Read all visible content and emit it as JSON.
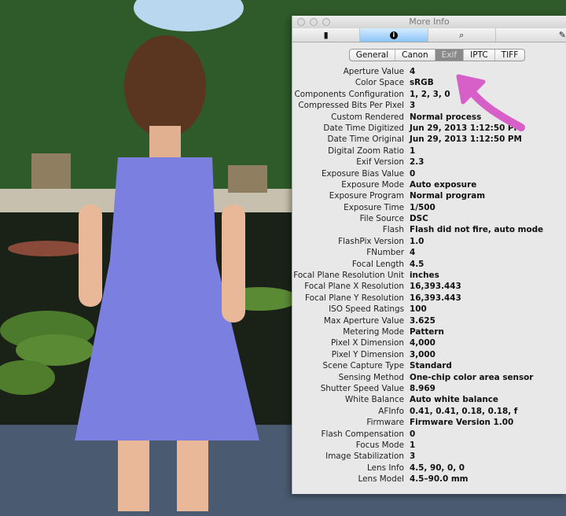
{
  "window": {
    "title": "More Info"
  },
  "toolbar": {
    "items": [
      {
        "icon": "document-icon"
      },
      {
        "icon": "info-icon",
        "selected": true
      },
      {
        "icon": "magnifier-icon"
      },
      {
        "icon": "pencil-icon"
      }
    ]
  },
  "tabs": [
    {
      "label": "General"
    },
    {
      "label": "Canon"
    },
    {
      "label": "Exif",
      "selected": true
    },
    {
      "label": "IPTC"
    },
    {
      "label": "TIFF"
    }
  ],
  "exif": [
    {
      "label": "Aperture Value",
      "value": "4"
    },
    {
      "label": "Color Space",
      "value": "sRGB"
    },
    {
      "label": "Components Configuration",
      "value": "1, 2, 3, 0"
    },
    {
      "label": "Compressed Bits Per Pixel",
      "value": "3"
    },
    {
      "label": "Custom Rendered",
      "value": "Normal process"
    },
    {
      "label": "Date Time Digitized",
      "value": "Jun 29, 2013 1:12:50 PM"
    },
    {
      "label": "Date Time Original",
      "value": "Jun 29, 2013 1:12:50 PM"
    },
    {
      "label": "Digital Zoom Ratio",
      "value": "1"
    },
    {
      "label": "Exif Version",
      "value": "2.3"
    },
    {
      "label": "Exposure Bias Value",
      "value": "0"
    },
    {
      "label": "Exposure Mode",
      "value": "Auto exposure"
    },
    {
      "label": "Exposure Program",
      "value": "Normal program"
    },
    {
      "label": "Exposure Time",
      "value": "1/500"
    },
    {
      "label": "File Source",
      "value": "DSC"
    },
    {
      "label": "Flash",
      "value": "Flash did not fire, auto mode"
    },
    {
      "label": "FlashPix Version",
      "value": "1.0"
    },
    {
      "label": "FNumber",
      "value": "4"
    },
    {
      "label": "Focal Length",
      "value": "4.5"
    },
    {
      "label": "Focal Plane Resolution Unit",
      "value": "inches"
    },
    {
      "label": "Focal Plane X Resolution",
      "value": "16,393.443"
    },
    {
      "label": "Focal Plane Y Resolution",
      "value": "16,393.443"
    },
    {
      "label": "ISO Speed Ratings",
      "value": "100"
    },
    {
      "label": "Max Aperture Value",
      "value": "3.625"
    },
    {
      "label": "Metering Mode",
      "value": "Pattern"
    },
    {
      "label": "Pixel X Dimension",
      "value": "4,000"
    },
    {
      "label": "Pixel Y Dimension",
      "value": "3,000"
    },
    {
      "label": "Scene Capture Type",
      "value": "Standard"
    },
    {
      "label": "Sensing Method",
      "value": "One-chip color area sensor"
    },
    {
      "label": "Shutter Speed Value",
      "value": "8.969"
    },
    {
      "label": "White Balance",
      "value": "Auto white balance"
    },
    {
      "label": "AFInfo",
      "value": "0.41, 0.41, 0.18, 0.18, f"
    },
    {
      "label": "Firmware",
      "value": "Firmware Version 1.00"
    },
    {
      "label": "Flash Compensation",
      "value": "0"
    },
    {
      "label": "Focus Mode",
      "value": "1"
    },
    {
      "label": "Image Stabilization",
      "value": "3"
    },
    {
      "label": "Lens Info",
      "value": "4.5, 90, 0, 0"
    },
    {
      "label": "Lens Model",
      "value": "4.5–90.0 mm"
    }
  ],
  "colors": {
    "arrow": "#d65fc8",
    "selected_toolbar": "#8cc4f7",
    "dress": "#7b7fe0"
  }
}
